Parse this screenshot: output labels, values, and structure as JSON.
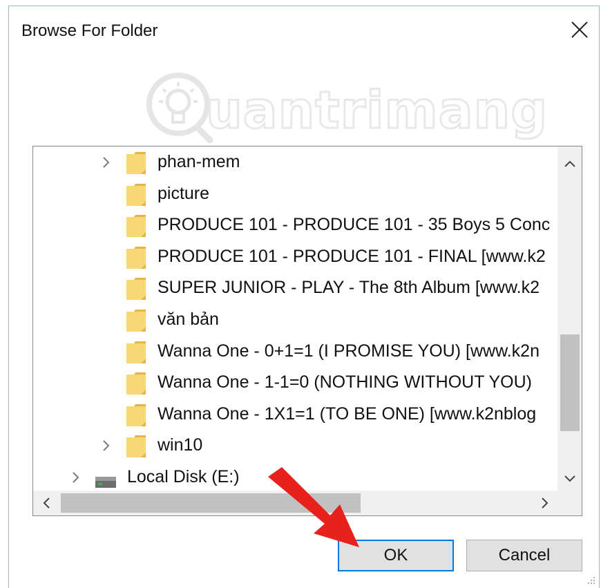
{
  "dialog": {
    "title": "Browse For Folder",
    "close_label": "✕"
  },
  "watermark": {
    "text": "uantrimang"
  },
  "tree": {
    "items": [
      {
        "label": "phan-mem",
        "expandable": true,
        "type": "folder"
      },
      {
        "label": "picture",
        "expandable": false,
        "type": "folder"
      },
      {
        "label": "PRODUCE 101 - PRODUCE 101 - 35 Boys 5 Conc",
        "expandable": false,
        "type": "folder"
      },
      {
        "label": "PRODUCE 101 - PRODUCE 101 - FINAL [www.k2",
        "expandable": false,
        "type": "folder"
      },
      {
        "label": "SUPER JUNIOR - PLAY - The 8th Album [www.k2",
        "expandable": false,
        "type": "folder"
      },
      {
        "label": "văn bản",
        "expandable": false,
        "type": "folder"
      },
      {
        "label": "Wanna One - 0+1=1 (I PROMISE YOU) [www.k2n",
        "expandable": false,
        "type": "folder"
      },
      {
        "label": "Wanna One - 1-1=0 (NOTHING WITHOUT YOU)",
        "expandable": false,
        "type": "folder"
      },
      {
        "label": "Wanna One - 1X1=1 (TO BE ONE) [www.k2nblog",
        "expandable": false,
        "type": "folder"
      },
      {
        "label": "win10",
        "expandable": true,
        "type": "folder"
      },
      {
        "label": "Local Disk (E:)",
        "expandable": true,
        "type": "drive"
      }
    ]
  },
  "buttons": {
    "ok": "OK",
    "cancel": "Cancel"
  },
  "colors": {
    "folder": "#f8d775",
    "folder_dark": "#e6b54a",
    "accent": "#0078d7",
    "arrow": "#e8211c"
  }
}
